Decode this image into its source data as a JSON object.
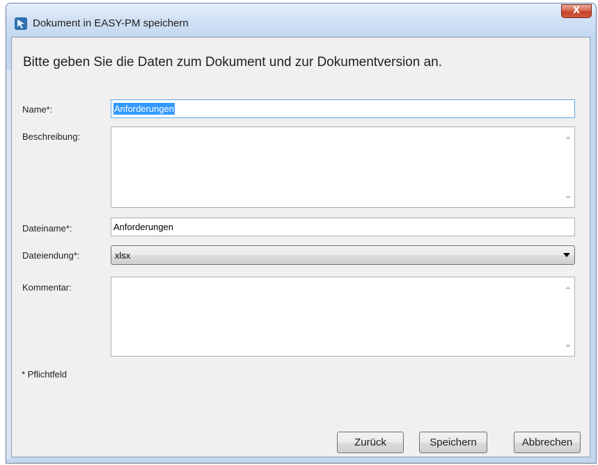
{
  "window": {
    "title": "Dokument in EASY-PM speichern",
    "close_label": "X"
  },
  "dialog": {
    "heading": "Bitte geben Sie die Daten zum Dokument und zur Dokumentversion an.",
    "name_label": "Name*:",
    "name_value": "Anforderungen",
    "description_label": "Beschreibung:",
    "description_value": "",
    "filename_label": "Dateiname*:",
    "filename_value": "Anforderungen",
    "extension_label": "Dateiendung*:",
    "extension_value": "xlsx",
    "comment_label": "Kommentar:",
    "comment_value": "",
    "required_note": "* Pflichtfeld"
  },
  "buttons": {
    "back": "Zurück",
    "save": "Speichern",
    "cancel": "Abbrechen"
  },
  "colors": {
    "selection": "#3399ff",
    "close_button": "#c3432a"
  }
}
